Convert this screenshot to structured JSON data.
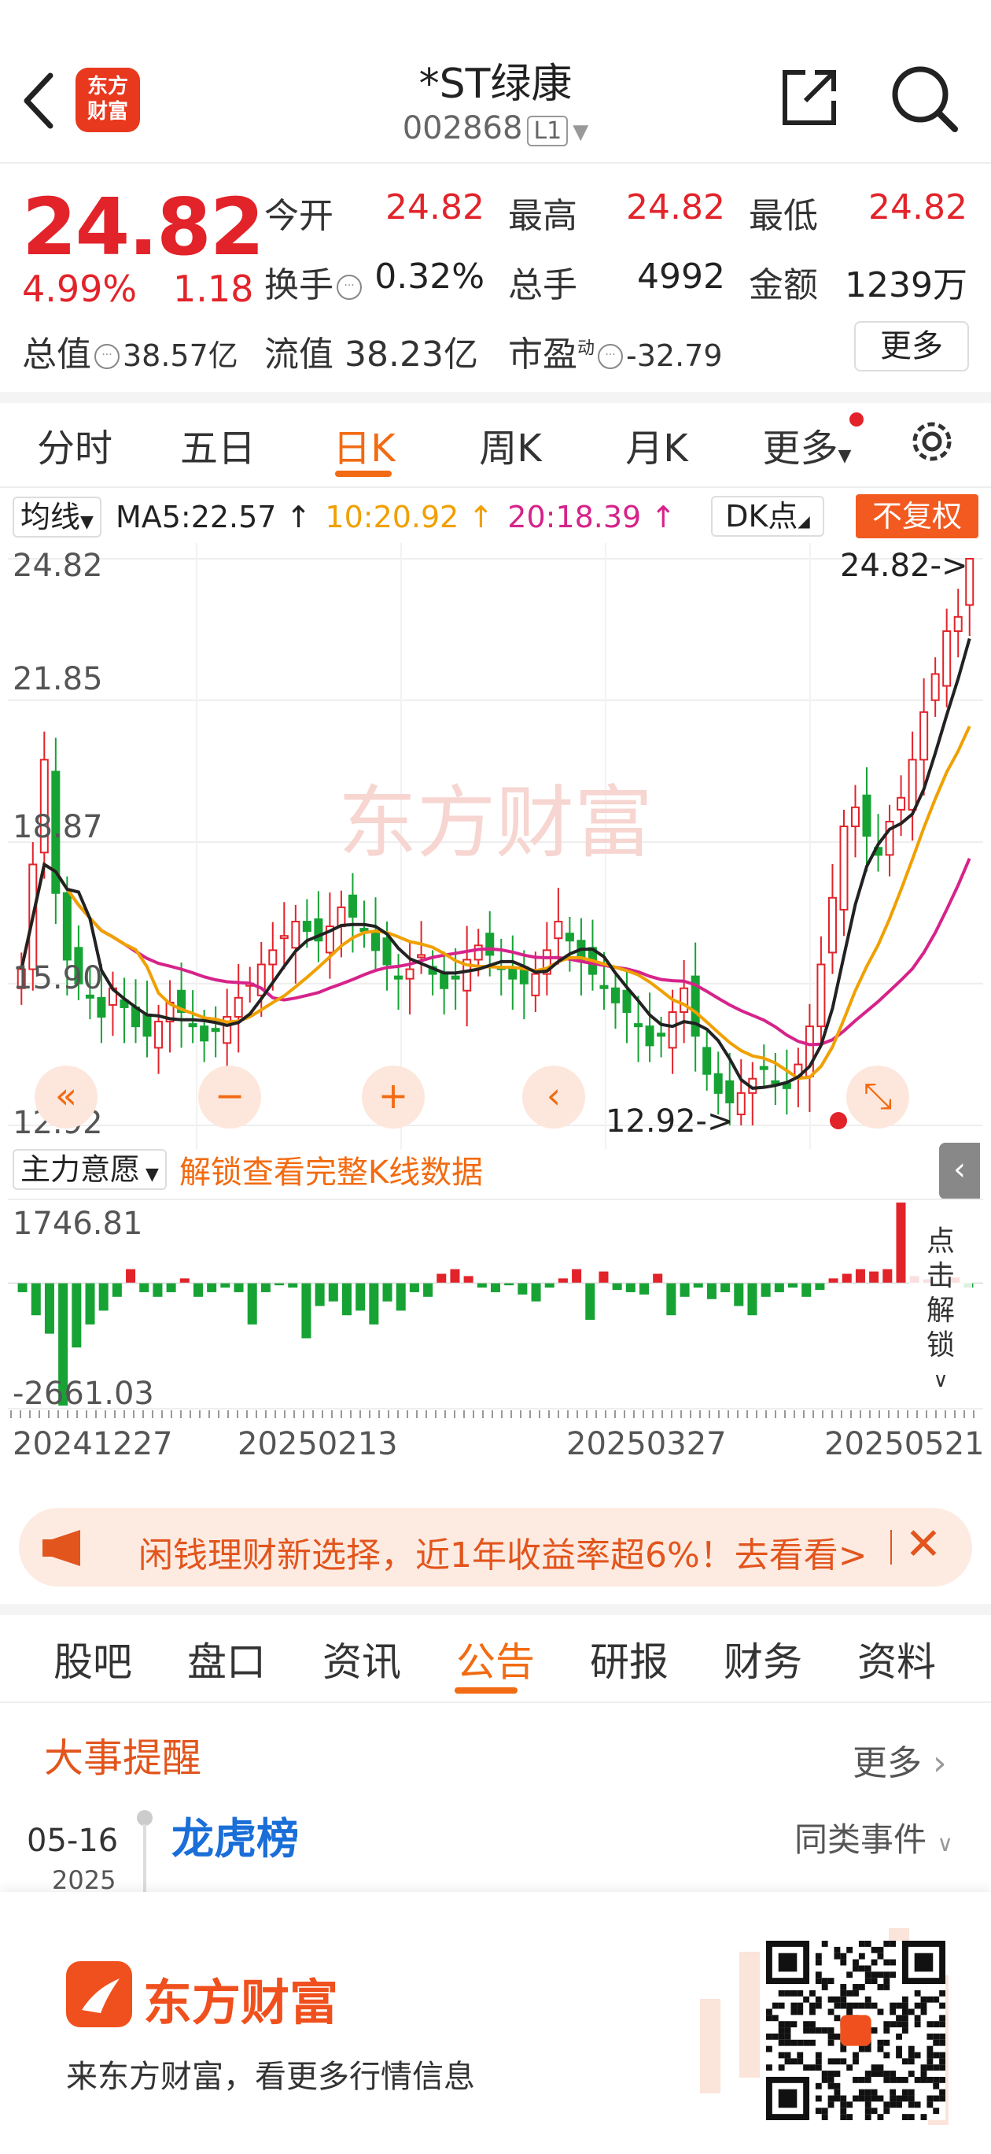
{
  "header": {
    "logo_line1": "东方",
    "logo_line2": "财富",
    "stock_name": "*ST绿康",
    "stock_code": "002868",
    "level": "L1"
  },
  "quote": {
    "price": "24.82",
    "change_pct": "4.99%",
    "change_amt": "1.18",
    "fields": {
      "open_label": "今开",
      "open": "24.82",
      "high_label": "最高",
      "high": "24.82",
      "low_label": "最低",
      "low": "24.82",
      "turnover_label": "换手",
      "turnover": "0.32%",
      "volume_label": "总手",
      "volume": "4992",
      "amount_label": "金额",
      "amount": "1239万",
      "mktcap_label": "总值",
      "mktcap": "38.57亿",
      "float_label": "流值",
      "float": "38.23亿",
      "pe_label": "市盈",
      "pe_sup": "动",
      "pe": "-32.79"
    },
    "more_label": "更多"
  },
  "period_tabs": [
    "分时",
    "五日",
    "日K",
    "周K",
    "月K",
    "更多"
  ],
  "active_period": "日K",
  "ma_bar": {
    "select_label": "均线",
    "ma5": "MA5:22.57",
    "ma10": "10:20.92",
    "ma20": "20:18.39",
    "dk_label": "DK点",
    "adjust_label": "不复权",
    "colors": {
      "ma5": "#222222",
      "ma10": "#f0a000",
      "ma20": "#d6238a",
      "up": "#e2232a",
      "down": "#16a334"
    }
  },
  "chart_labels": {
    "y_top": "24.82",
    "y_2": "21.85",
    "y_3": "18.87",
    "y_4": "15.90",
    "y_bottom": "12.92",
    "max_marker": "24.82->",
    "min_marker": "12.92->",
    "watermark": "东方财富"
  },
  "chart_data": {
    "type": "candlestick",
    "y_ticks": [
      24.82,
      21.85,
      18.87,
      15.9,
      12.92
    ],
    "ylim": [
      12.92,
      24.82
    ],
    "x_ticks": [
      "20241227",
      "20250213",
      "20250327",
      "20250521"
    ],
    "ma_current": {
      "MA5": 22.57,
      "MA10": 20.92,
      "MA20": 18.39
    },
    "high_marker": 24.82,
    "low_marker": 12.92,
    "closes": [
      16.2,
      18.4,
      20.6,
      17.8,
      16.4,
      15.9,
      15.6,
      15.2,
      15.8,
      15.4,
      15.0,
      14.8,
      15.1,
      15.5,
      15.3,
      15.0,
      14.7,
      14.9,
      15.2,
      15.6,
      15.9,
      16.3,
      16.6,
      16.9,
      17.2,
      17.0,
      16.8,
      17.1,
      17.5,
      17.3,
      17.0,
      16.6,
      16.3,
      16.0,
      16.2,
      16.5,
      16.1,
      15.8,
      16.0,
      16.4,
      16.7,
      16.5,
      16.2,
      16.0,
      15.9,
      16.1,
      16.6,
      17.2,
      16.8,
      16.4,
      16.1,
      15.8,
      15.5,
      15.3,
      15.0,
      14.6,
      14.8,
      15.3,
      15.8,
      14.8,
      14.0,
      13.6,
      13.4,
      13.6,
      13.9,
      14.1,
      13.8,
      13.7,
      14.2,
      15.0,
      16.3,
      17.7,
      19.2,
      19.6,
      19.0,
      18.6,
      19.3,
      19.8,
      20.6,
      21.6,
      22.4,
      23.3,
      23.6,
      24.82
    ],
    "indicator": {
      "name": "主力意愿",
      "ylim": [
        -2661.03,
        1746.81
      ],
      "values": [
        -200,
        -700,
        -1100,
        -2661,
        -1400,
        -900,
        -600,
        -300,
        300,
        -200,
        -300,
        -200,
        100,
        -300,
        -200,
        -100,
        -200,
        -900,
        -200,
        -50,
        -100,
        -1200,
        -500,
        -400,
        -700,
        -600,
        -900,
        -400,
        -600,
        -200,
        -300,
        200,
        300,
        150,
        -100,
        -200,
        -50,
        -250,
        -400,
        -100,
        100,
        300,
        -800,
        250,
        -150,
        -200,
        -250,
        200,
        -700,
        -300,
        -100,
        -350,
        -200,
        -500,
        -700,
        -300,
        -200,
        -100,
        -300,
        -150,
        100,
        200,
        300,
        250,
        300,
        1746,
        150,
        80,
        -50,
        120,
        -100
      ],
      "labels": [
        "1746.81",
        "-2661.03"
      ]
    }
  },
  "indicator_bar": {
    "select_label": "主力意愿",
    "unlock_text": "解锁查看完整K线数据",
    "side_unlock": [
      "点",
      "击",
      "解",
      "锁"
    ]
  },
  "x_axis": {
    "d1": "20241227",
    "d2": "20250213",
    "d3": "20250327",
    "d4": "20250521"
  },
  "banner": {
    "text": "闲钱理财新选择，近1年收益率超6%！去看看>"
  },
  "content_tabs": [
    "股吧",
    "盘口",
    "资讯",
    "公告",
    "研报",
    "财务",
    "资料"
  ],
  "active_content_tab": "公告",
  "events": {
    "section_title": "大事提醒",
    "more_label": "更多",
    "item": {
      "date": "05-16",
      "year": "2025",
      "title": "龙虎榜",
      "similar_label": "同类事件"
    }
  },
  "footer": {
    "brand": "东方财富",
    "slogan": "来东方财富，看更多行情信息"
  }
}
